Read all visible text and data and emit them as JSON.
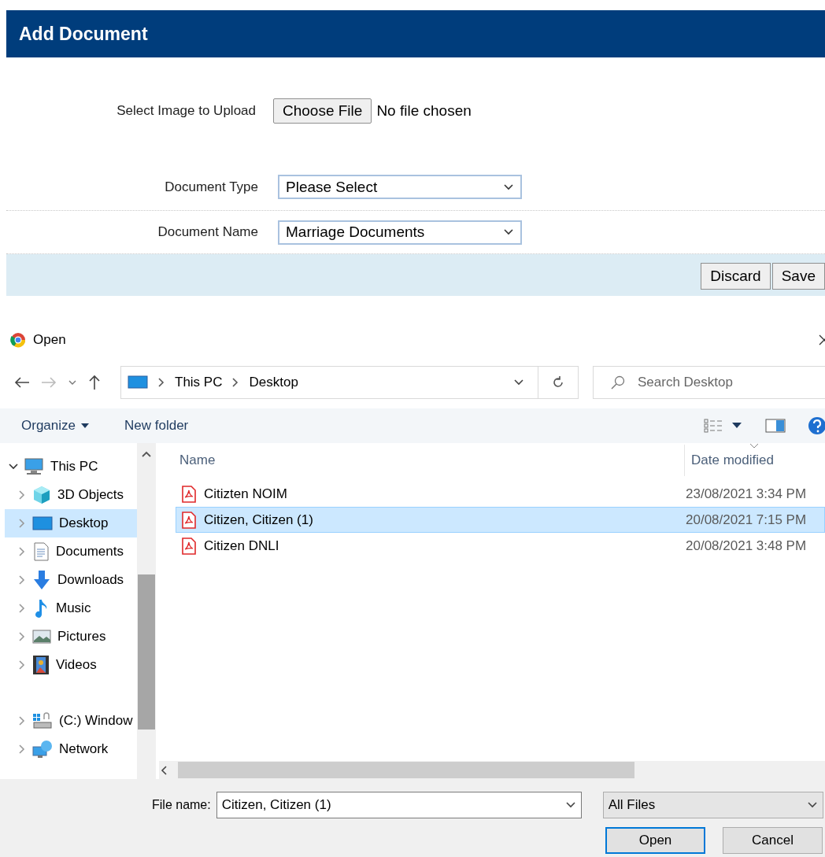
{
  "page": {
    "title": "Add Document",
    "upload": {
      "label": "Select Image to Upload",
      "button": "Choose File",
      "status": "No file chosen"
    },
    "selects": [
      {
        "label": "Document Type",
        "value": "Please Select"
      },
      {
        "label": "Document Name",
        "value": "Marriage Documents"
      }
    ],
    "buttons": [
      "Discard",
      "Save"
    ]
  },
  "dialog": {
    "title": "Open",
    "breadcrumb": [
      "This PC",
      "Desktop"
    ],
    "search": {
      "placeholder": "Search Desktop"
    },
    "toolbar": {
      "organize": "Organize",
      "new_folder": "New folder"
    },
    "tree": [
      {
        "name": "This PC",
        "kind": "pc",
        "expanded": true,
        "selected": false,
        "children": [
          {
            "name": "3D Objects",
            "kind": "cube",
            "expanded": false,
            "selected": false
          },
          {
            "name": "Desktop",
            "kind": "desktop",
            "expanded": false,
            "selected": true
          },
          {
            "name": "Documents",
            "kind": "documents",
            "expanded": false,
            "selected": false
          },
          {
            "name": "Downloads",
            "kind": "downloads",
            "expanded": false,
            "selected": false
          },
          {
            "name": "Music",
            "kind": "music",
            "expanded": false,
            "selected": false
          },
          {
            "name": "Pictures",
            "kind": "pictures",
            "expanded": false,
            "selected": false
          },
          {
            "name": "Videos",
            "kind": "videos",
            "expanded": false,
            "selected": false
          },
          {
            "name": "(C:) Window",
            "kind": "drive",
            "expanded": false,
            "selected": false
          },
          {
            "name": "Network",
            "kind": "network",
            "expanded": false,
            "selected": false
          }
        ]
      }
    ],
    "columns": [
      "Name",
      "Date modified"
    ],
    "files": [
      {
        "name": "Citizten NOIM",
        "date": "23/08/2021 3:34 PM",
        "selected": false
      },
      {
        "name": "Citizen, Citizen (1)",
        "date": "20/08/2021 7:15 PM",
        "selected": true
      },
      {
        "name": "Citizen DNLI",
        "date": "20/08/2021 3:48 PM",
        "selected": false
      }
    ],
    "file_name": {
      "label": "File name:",
      "value": "Citizen, Citizen (1)"
    },
    "filter": "All Files",
    "buttons": [
      "Open",
      "Cancel"
    ]
  }
}
